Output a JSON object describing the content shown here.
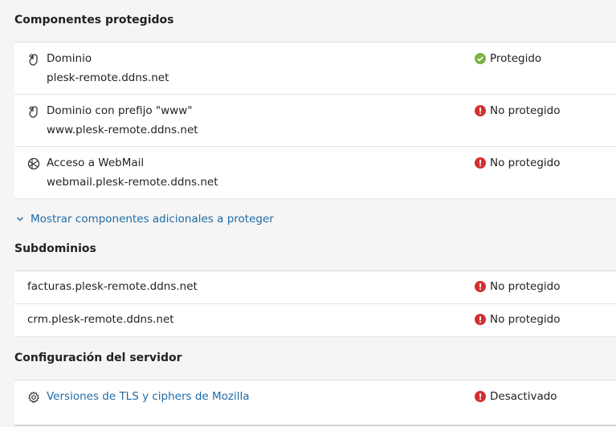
{
  "protected_components": {
    "title": "Componentes protegidos",
    "rows": [
      {
        "icon": "domain-icon",
        "name": "Dominio",
        "sub": "plesk-remote.ddns.net",
        "status": "Protegido",
        "status_kind": "ok"
      },
      {
        "icon": "domain-icon",
        "name": "Dominio con prefijo \"www\"",
        "sub": "www.plesk-remote.ddns.net",
        "status": "No protegido",
        "status_kind": "error"
      },
      {
        "icon": "webmail-icon",
        "name": "Acceso a WebMail",
        "sub": "webmail.plesk-remote.ddns.net",
        "status": "No protegido",
        "status_kind": "error"
      }
    ]
  },
  "show_more": {
    "label": "Mostrar componentes adicionales a proteger",
    "icon": "chevron-down-icon"
  },
  "subdomains": {
    "title": "Subdominios",
    "rows": [
      {
        "name": "facturas.plesk-remote.ddns.net",
        "status": "No protegido",
        "status_kind": "error"
      },
      {
        "name": "crm.plesk-remote.ddns.net",
        "status": "No protegido",
        "status_kind": "error"
      }
    ]
  },
  "server_config": {
    "title": "Configuración del servidor",
    "rows": [
      {
        "icon": "gear-icon",
        "name": "Versiones de TLS y ciphers de Mozilla",
        "status": "Desactivado",
        "status_kind": "error"
      }
    ]
  },
  "colors": {
    "ok": "#7cb342",
    "error": "#d32f2f",
    "link": "#1e6ba5"
  }
}
